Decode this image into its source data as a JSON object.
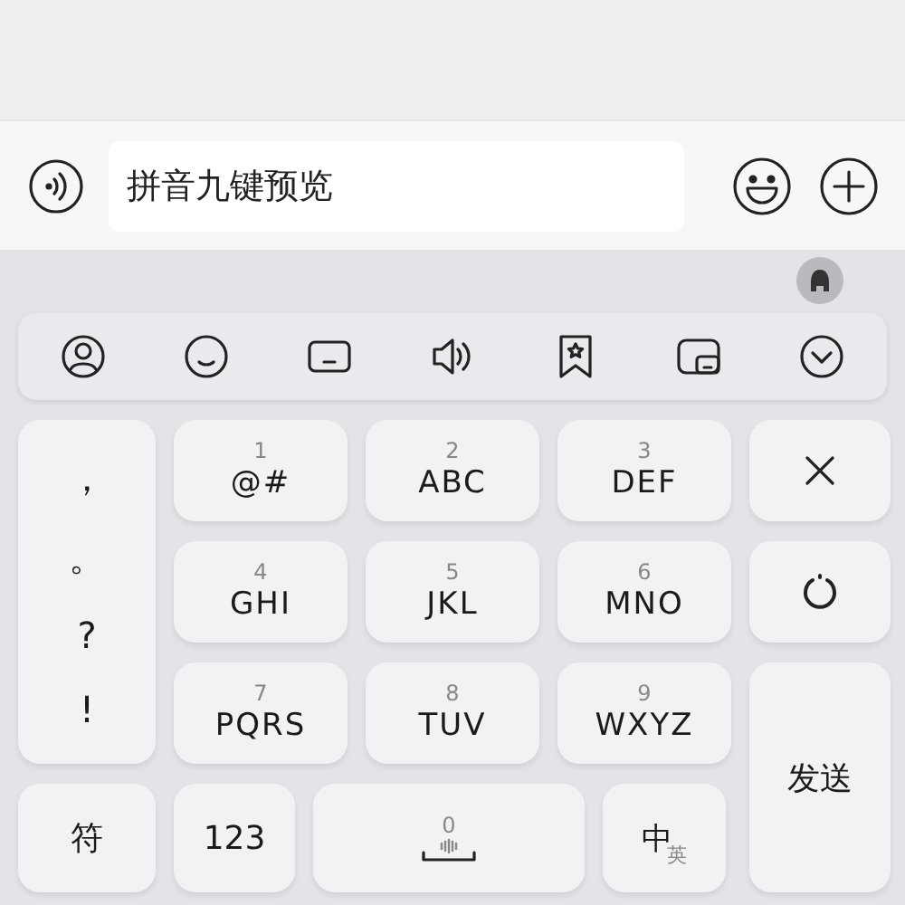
{
  "input_bar": {
    "value": "拼音九键预览"
  },
  "punctuation": [
    "，",
    "。",
    "?",
    "!"
  ],
  "keys": [
    {
      "digit": "1",
      "letters": "@#"
    },
    {
      "digit": "2",
      "letters": "ABC"
    },
    {
      "digit": "3",
      "letters": "DEF"
    },
    {
      "digit": "4",
      "letters": "GHI"
    },
    {
      "digit": "5",
      "letters": "JKL"
    },
    {
      "digit": "6",
      "letters": "MNO"
    },
    {
      "digit": "7",
      "letters": "PQRS"
    },
    {
      "digit": "8",
      "letters": "TUV"
    },
    {
      "digit": "9",
      "letters": "WXYZ"
    }
  ],
  "bottom_row": {
    "symbols": "符",
    "numbers": "123",
    "space_digit": "0",
    "language_main": "中",
    "language_sub": "英"
  },
  "send": "发送"
}
